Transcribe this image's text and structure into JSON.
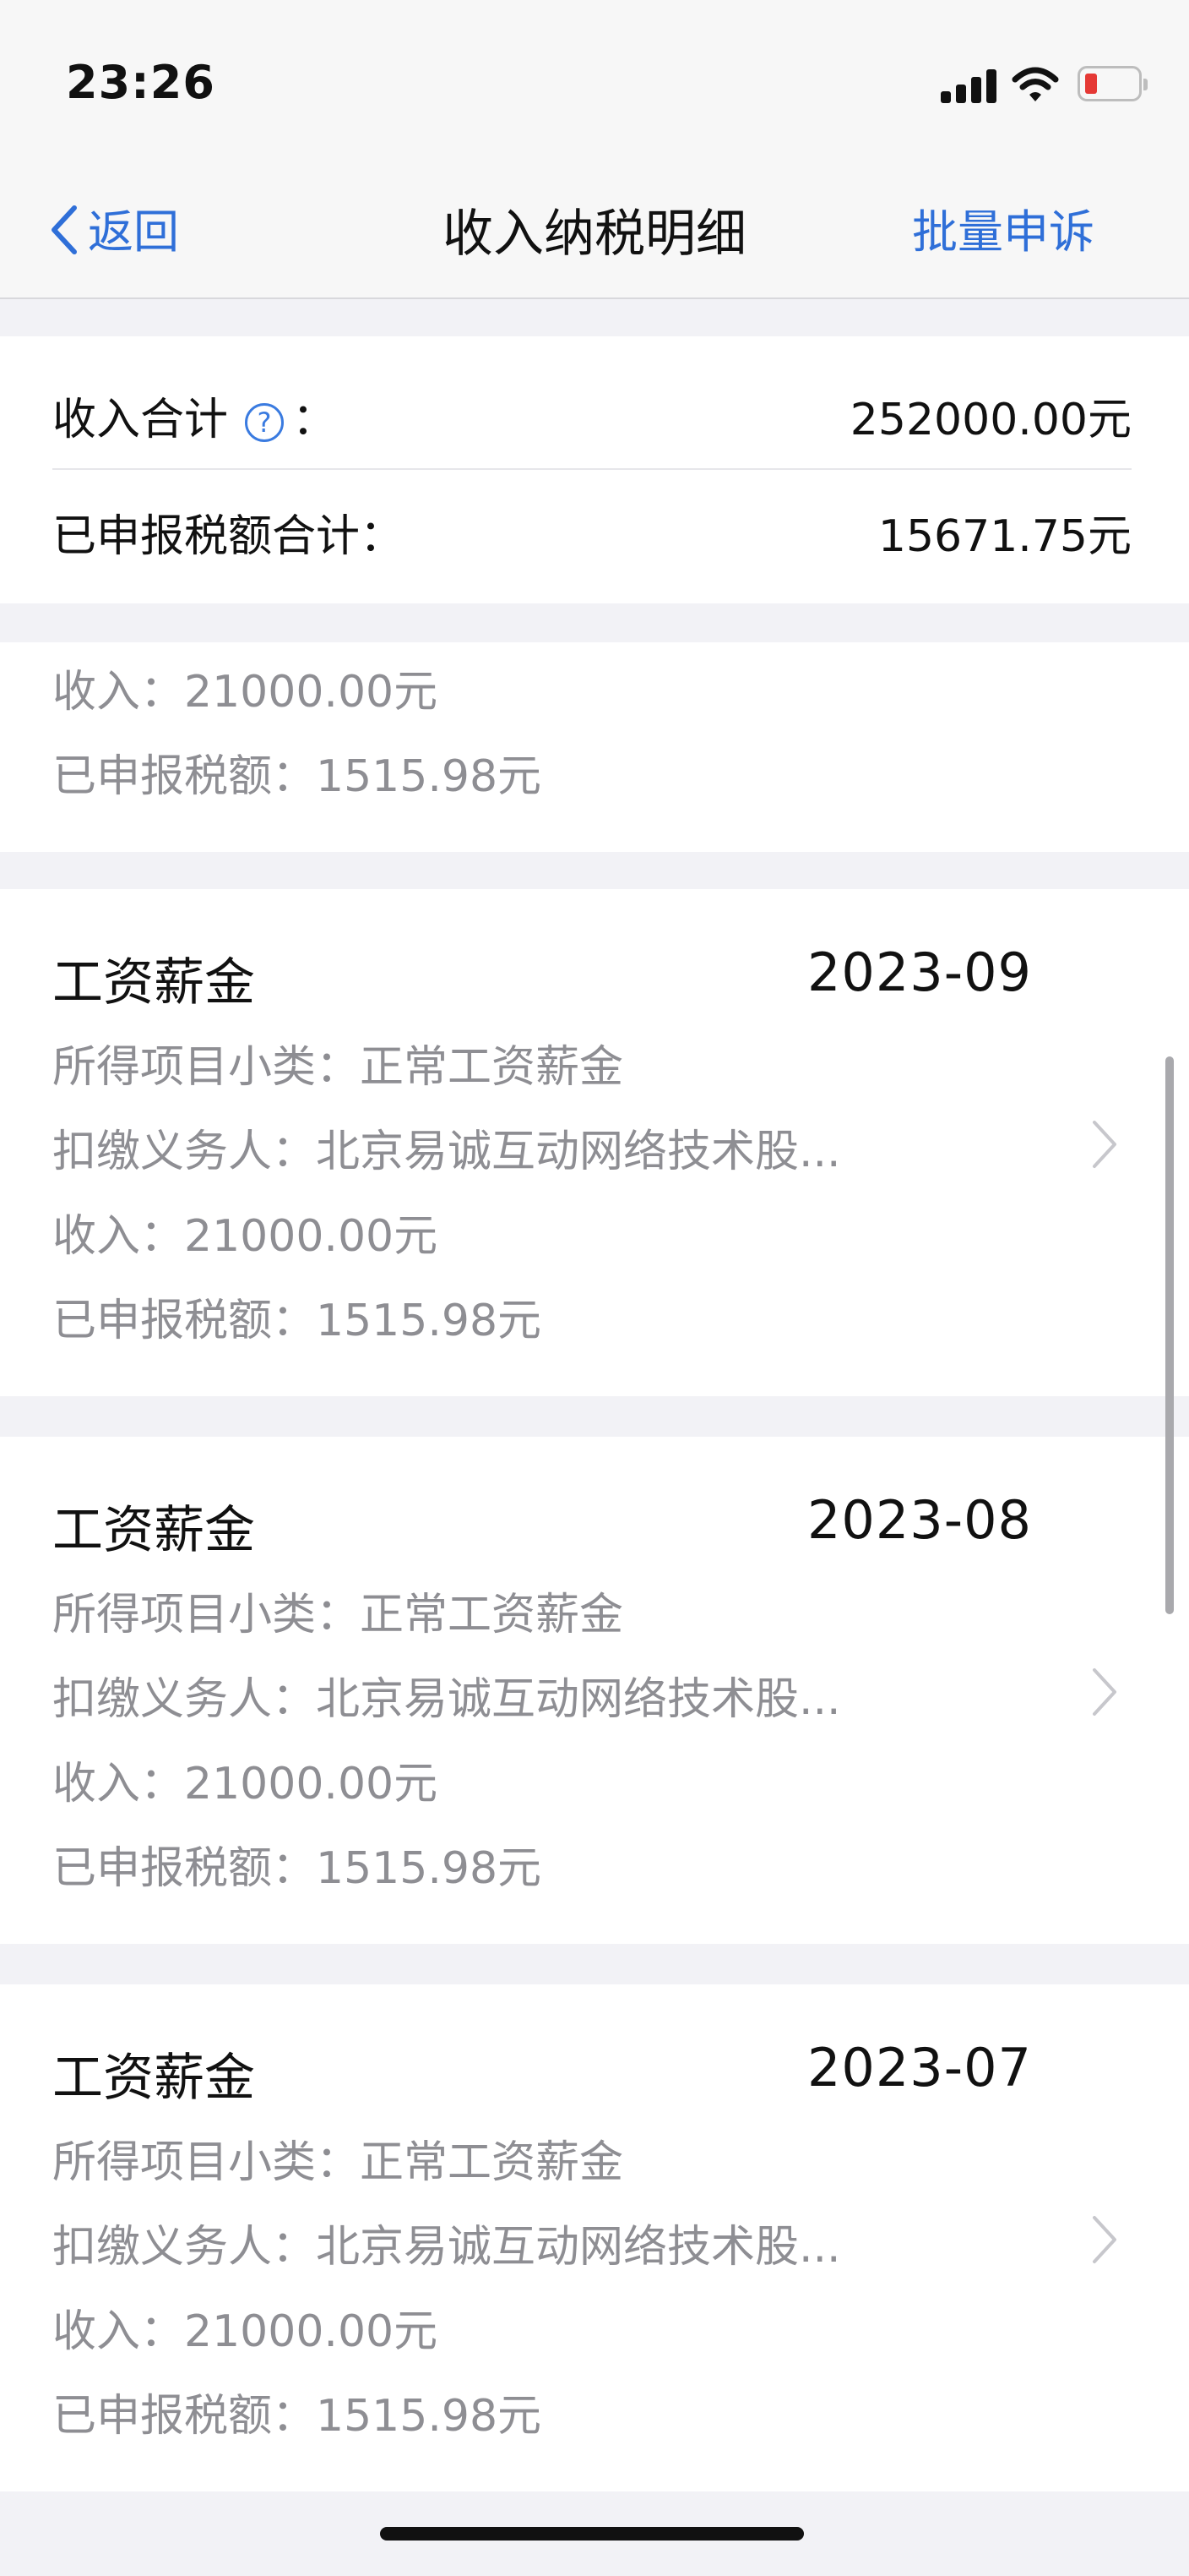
{
  "status": {
    "time": "23:26"
  },
  "nav": {
    "back_label": "返回",
    "title": "收入纳税明细",
    "batch_label": "批量申诉"
  },
  "summary": {
    "income_label": "收入合计",
    "help_glyph": "?",
    "income_colon": "：",
    "income_value": "252000.00元",
    "tax_label": "已申报税额合计：",
    "tax_value": "15671.75元"
  },
  "partial_record": {
    "income": "收入：21000.00元",
    "tax": "已申报税额：1515.98元"
  },
  "records": [
    {
      "title": "工资薪金",
      "date": "2023-09",
      "subcategory": "所得项目小类：正常工资薪金",
      "withholder": "扣缴义务人：北京易诚互动网络技术股...",
      "income": "收入：21000.00元",
      "tax": "已申报税额：1515.98元"
    },
    {
      "title": "工资薪金",
      "date": "2023-08",
      "subcategory": "所得项目小类：正常工资薪金",
      "withholder": "扣缴义务人：北京易诚互动网络技术股...",
      "income": "收入：21000.00元",
      "tax": "已申报税额：1515.98元"
    },
    {
      "title": "工资薪金",
      "date": "2023-07",
      "subcategory": "所得项目小类：正常工资薪金",
      "withholder": "扣缴义务人：北京易诚互动网络技术股...",
      "income": "收入：21000.00元",
      "tax": "已申报税额：1515.98元"
    }
  ],
  "icons": {
    "back": "chevron-left-icon",
    "help": "question-circle-icon",
    "row_chevron": "chevron-right-icon"
  },
  "colors": {
    "accent": "#2f6fd8",
    "secondary_text": "#8e8e93",
    "background": "#f2f2f6",
    "battery_low": "#e53935"
  }
}
